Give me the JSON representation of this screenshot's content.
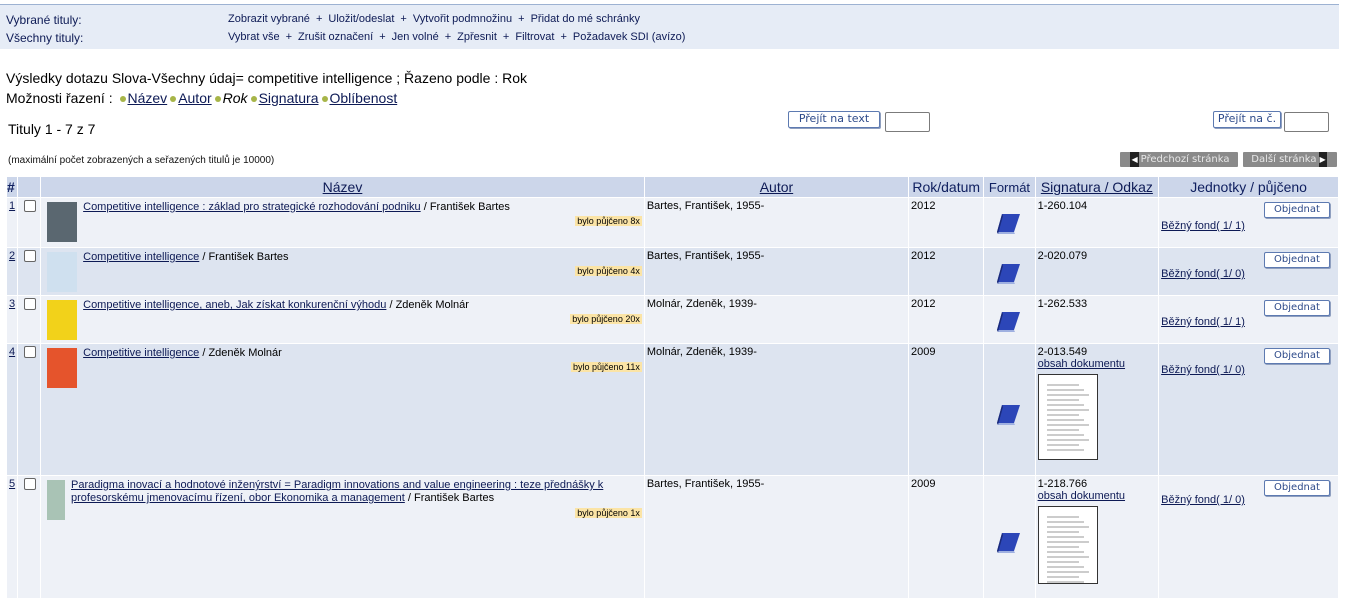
{
  "topbar": {
    "selected_label": "Vybrané tituly:",
    "all_label": "Všechny tituly:",
    "selected_actions": [
      "Zobrazit vybrané",
      "Uložit/odeslat",
      "Vytvořit podmnožinu",
      "Přidat do mé schránky"
    ],
    "all_actions": [
      "Vybrat vše",
      "Zrušit označení",
      "Jen volné",
      "Zpřesnit",
      "Filtrovat",
      "Požadavek SDI (avízo)"
    ],
    "separator": "+"
  },
  "query": {
    "text": "Výsledky dotazu Slova-Všechny údaj= competitive intelligence ; Řazeno podle : Rok",
    "sort_label": "Možnosti řazení :",
    "sort_options": [
      {
        "label": "Název",
        "link": true
      },
      {
        "label": "Autor",
        "link": true
      },
      {
        "label": "Rok",
        "link": false
      },
      {
        "label": "Signatura",
        "link": true
      },
      {
        "label": "Oblíbenost",
        "link": true
      }
    ]
  },
  "results": {
    "count_text": "Tituly 1 - 7 z 7",
    "goto_text_button": "Přejít na text",
    "goto_num_button": "Přejít na č.",
    "max_note": "(maximální počet zobrazených a seřazených titulů je 10000)",
    "prev_page": "Předchozí stránka",
    "next_page": "Další stránka"
  },
  "table": {
    "headers": {
      "num": "#",
      "title": "Název",
      "author": "Autor",
      "year": "Rok/datum",
      "format": "Formát",
      "signature": "Signatura / Odkaz",
      "units": "Jednotky / půjčeno"
    },
    "order_label": "Objednat",
    "rows": [
      {
        "num": "1",
        "title_link": "Competitive intelligence : základ pro strategické rozhodování podniku",
        "title_rest": " / František Bartes",
        "loan": "bylo půjčeno 8x",
        "author": "Bartes, František, 1955-",
        "year": "2012",
        "signature": "1-260.104",
        "content_link": "",
        "unit": "Běžný fond( 1/ 1)",
        "cover": "#5a6770"
      },
      {
        "num": "2",
        "title_link": "Competitive intelligence",
        "title_rest": " / František Bartes",
        "loan": "bylo půjčeno 4x",
        "author": "Bartes, František, 1955-",
        "year": "2012",
        "signature": "2-020.079",
        "content_link": "",
        "unit": "Běžný fond( 1/ 0)",
        "cover": "#cfe0ef"
      },
      {
        "num": "3",
        "title_link": "Competitive intelligence, aneb, Jak získat konkurenční výhodu",
        "title_rest": " / Zdeněk Molnár",
        "loan": "bylo půjčeno 20x",
        "author": "Molnár, Zdeněk, 1939-",
        "year": "2012",
        "signature": "1-262.533",
        "content_link": "",
        "unit": "Běžný fond( 1/ 1)",
        "cover": "#f2d21a"
      },
      {
        "num": "4",
        "title_link": "Competitive intelligence",
        "title_rest": " / Zdeněk Molnár",
        "loan": "bylo půjčeno 11x",
        "author": "Molnár, Zdeněk, 1939-",
        "year": "2009",
        "signature": "2-013.549",
        "content_link": "obsah dokumentu",
        "unit": "Běžný fond( 1/ 0)",
        "cover": "#e5542c"
      },
      {
        "num": "5",
        "title_link": "Paradigma inovací a hodnotové inženýrství = Paradigm innovations and value engineering : teze přednášky k profesorskému jmenovacímu řízení, obor Ekonomika a management",
        "title_rest": " / František Bartes",
        "loan": "bylo půjčeno 1x",
        "author": "Bartes, František, 1955-",
        "year": "2009",
        "signature": "1-218.766",
        "content_link": "obsah dokumentu",
        "unit": "Běžný fond( 1/ 0)",
        "cover": "#a9c3b5"
      }
    ]
  }
}
